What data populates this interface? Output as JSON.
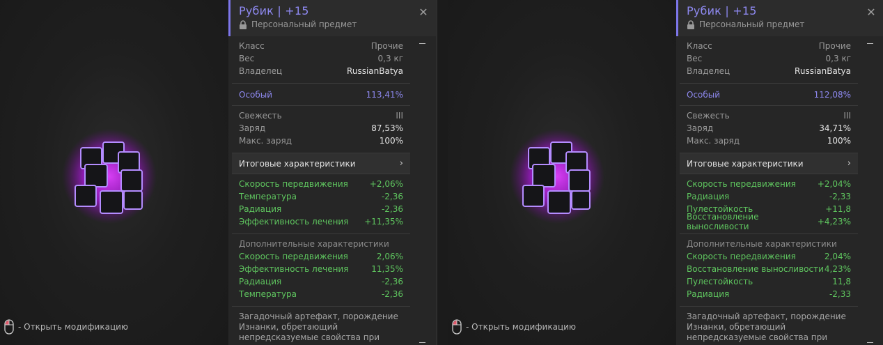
{
  "panels": [
    {
      "title": "Рубик | +15",
      "subtitle": "Персональный предмет",
      "hint": "- Открыть модификацию",
      "info": [
        {
          "label": "Класс",
          "value": "Прочие"
        },
        {
          "label": "Вес",
          "value": "0,3 кг"
        },
        {
          "label": "Владелец",
          "value": "RussianBatya"
        }
      ],
      "rarity": {
        "label": "Особый",
        "value": "113,41%"
      },
      "state": [
        {
          "label": "Свежесть",
          "value": "III"
        },
        {
          "label": "Заряд",
          "value": "87,53%"
        },
        {
          "label": "Макс. заряд",
          "value": "100%"
        }
      ],
      "summary_label": "Итоговые характеристики",
      "stats": [
        {
          "label": "Скорость передвижения",
          "value": "+2,06%"
        },
        {
          "label": "Температура",
          "value": "-2,36"
        },
        {
          "label": "Радиация",
          "value": "-2,36"
        },
        {
          "label": "Эффективность лечения",
          "value": "+11,35%"
        }
      ],
      "extra_title": "Дополнительные характеристики",
      "extra": [
        {
          "label": "Скорость передвижения",
          "value": "2,06%"
        },
        {
          "label": "Эффективность лечения",
          "value": "11,35%"
        },
        {
          "label": "Радиация",
          "value": "-2,36"
        },
        {
          "label": "Температура",
          "value": "-2,36"
        }
      ],
      "description": "Загадочный артефакт, порождение Изнанки, обретающий непредсказуемые свойства при повышении потенциала."
    },
    {
      "title": "Рубик | +15",
      "subtitle": "Персональный предмет",
      "hint": "- Открыть модификацию",
      "info": [
        {
          "label": "Класс",
          "value": "Прочие"
        },
        {
          "label": "Вес",
          "value": "0,3 кг"
        },
        {
          "label": "Владелец",
          "value": "RussianBatya"
        }
      ],
      "rarity": {
        "label": "Особый",
        "value": "112,08%"
      },
      "state": [
        {
          "label": "Свежесть",
          "value": "III"
        },
        {
          "label": "Заряд",
          "value": "34,71%"
        },
        {
          "label": "Макс. заряд",
          "value": "100%"
        }
      ],
      "summary_label": "Итоговые характеристики",
      "stats": [
        {
          "label": "Скорость передвижения",
          "value": "+2,04%"
        },
        {
          "label": "Радиация",
          "value": "-2,33"
        },
        {
          "label": "Пулестойкость",
          "value": "+11,8"
        },
        {
          "label": "Восстановление выносливости",
          "value": "+4,23%"
        }
      ],
      "extra_title": "Дополнительные характеристики",
      "extra": [
        {
          "label": "Скорость передвижения",
          "value": "2,04%"
        },
        {
          "label": "Восстановление выносливости",
          "value": "4,23%"
        },
        {
          "label": "Пулестойкость",
          "value": "11,8"
        },
        {
          "label": "Радиация",
          "value": "-2,33"
        }
      ],
      "description": "Загадочный артефакт, порождение Изнанки, обретающий непредсказуемые свойства при повышении потенциала."
    }
  ],
  "colors": {
    "accent": "#8e89f0",
    "positive": "#5fc65f",
    "glow": "#d020ff"
  },
  "icons": [
    "cube-artifact-icon",
    "mouse-icon",
    "lock-icon",
    "close-icon",
    "chevron-right-icon"
  ]
}
